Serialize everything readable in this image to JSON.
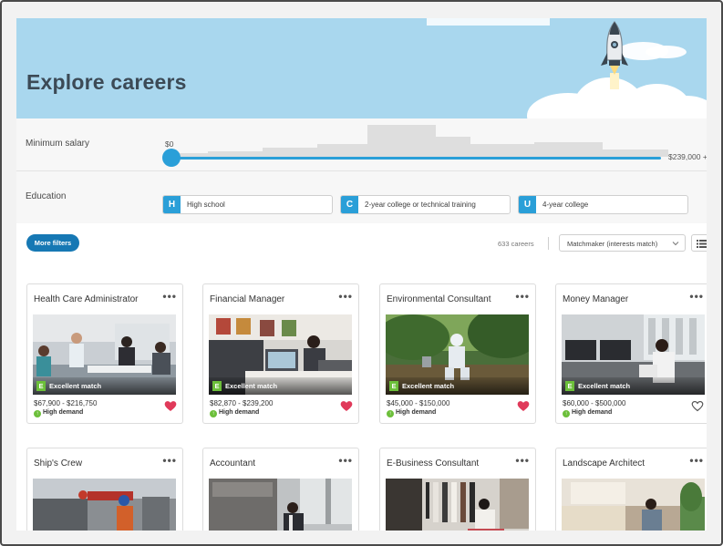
{
  "hero": {
    "title": "Explore careers"
  },
  "filters": {
    "salary": {
      "label": "Minimum salary",
      "min_value": "$0",
      "max_value": "$239,000 +"
    },
    "education": {
      "label": "Education",
      "options": [
        {
          "letter": "H",
          "label": "High school"
        },
        {
          "letter": "C",
          "label": "2-year college or technical training"
        },
        {
          "letter": "U",
          "label": "4-year college"
        }
      ]
    }
  },
  "toolbar": {
    "more_filters_label": "More filters",
    "count": "633 careers",
    "sort_label": "Matchmaker (interests match)"
  },
  "cards": [
    {
      "title": "Health Care Administrator",
      "match": "Excellent match",
      "match_letter": "E",
      "salary": "$67,900 - $216,750",
      "demand": "High demand",
      "favorited": true
    },
    {
      "title": "Financial Manager",
      "match": "Excellent match",
      "match_letter": "E",
      "salary": "$82,870 - $239,200",
      "demand": "High demand",
      "favorited": true
    },
    {
      "title": "Environmental Consultant",
      "match": "Excellent match",
      "match_letter": "E",
      "salary": "$45,000 - $150,000",
      "demand": "High demand",
      "favorited": true
    },
    {
      "title": "Money Manager",
      "match": "Excellent match",
      "match_letter": "E",
      "salary": "$60,000 - $500,000",
      "demand": "High demand",
      "favorited": false
    },
    {
      "title": "Ship's Crew"
    },
    {
      "title": "Accountant"
    },
    {
      "title": "E-Business Consultant"
    },
    {
      "title": "Landscape Architect"
    }
  ],
  "more_icon": "•••",
  "colors": {
    "accent": "#2a9fd8",
    "hero_bg": "#a9d7ee",
    "match_green": "#6cbf3a",
    "heart_red": "#e03a5a",
    "button_blue": "#1678b4"
  }
}
